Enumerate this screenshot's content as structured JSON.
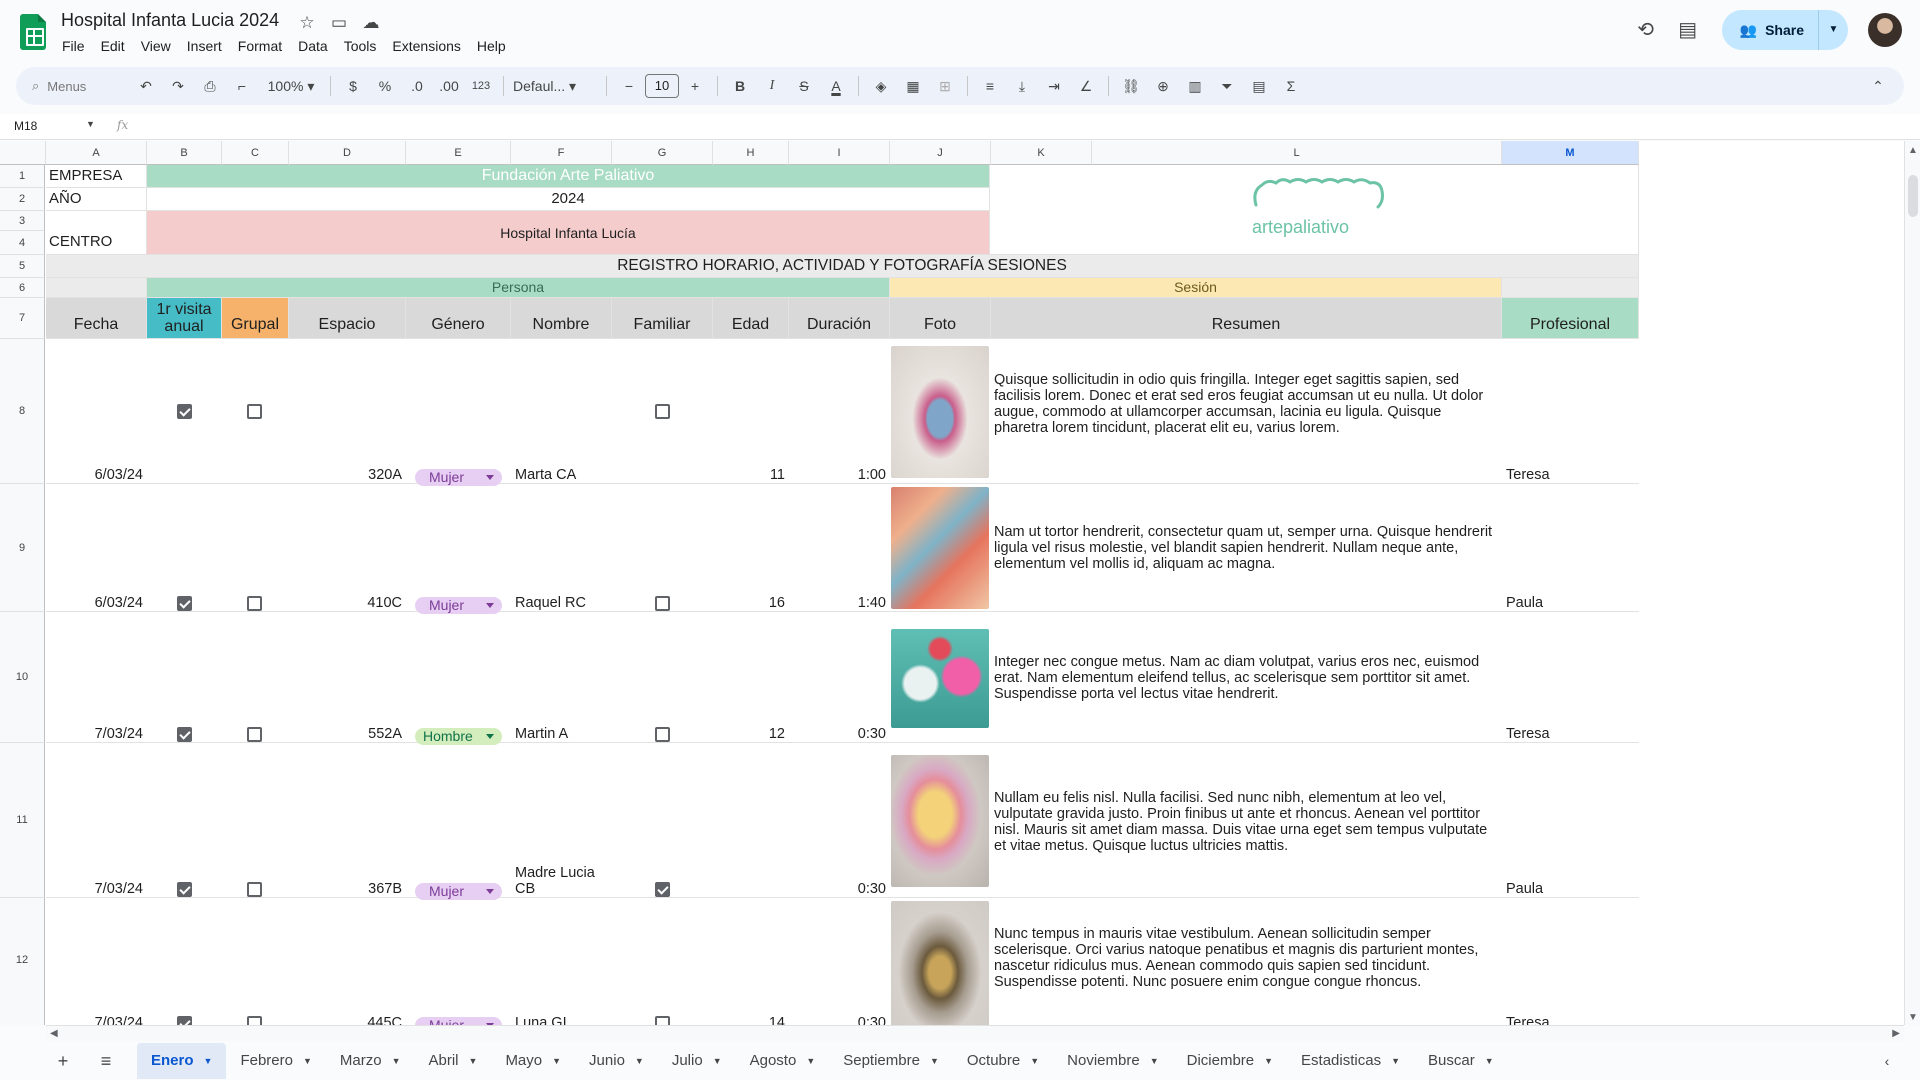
{
  "app": {
    "title": "Hospital Infanta Lucia 2024",
    "menu": [
      "File",
      "Edit",
      "View",
      "Insert",
      "Format",
      "Data",
      "Tools",
      "Extensions",
      "Help"
    ],
    "share_label": "Share"
  },
  "toolbar": {
    "search_placeholder": "Menus",
    "zoom": "100%",
    "currency": "$",
    "percent": "%",
    "dec_decrease": ".0",
    "dec_increase": ".00",
    "number_format": "123",
    "font": "Defaul...",
    "font_size": "10",
    "bold": "B",
    "italic": "I",
    "strike": "S",
    "text_color": "A"
  },
  "formula_bar": {
    "name_box": "M18",
    "fx": "fx"
  },
  "columns": [
    "A",
    "B",
    "C",
    "D",
    "E",
    "F",
    "G",
    "H",
    "I",
    "J",
    "K",
    "L",
    "M"
  ],
  "rows": [
    "1",
    "2",
    "3",
    "4",
    "5",
    "6",
    "7",
    "8",
    "9",
    "10",
    "11",
    "12"
  ],
  "sheet": {
    "empresa_label": "EMPRESA",
    "empresa_value": "Fundación Arte Paliativo",
    "anio_label": "AÑO",
    "anio_value": "2024",
    "centro_label": "CENTRO",
    "centro_value": "Hospital Infanta Lucía",
    "logo_text": "artepaliativo",
    "registro_title": "REGISTRO HORARIO, ACTIVIDAD Y  FOTOGRAFÍA SESIONES",
    "group_persona": "Persona",
    "group_sesion": "Sesión",
    "headers": {
      "fecha": "Fecha",
      "visita": "1r visita anual",
      "grupal": "Grupal",
      "espacio": "Espacio",
      "genero": "Género",
      "nombre": "Nombre",
      "familiar": "Familiar",
      "edad": "Edad",
      "duracion": "Duración",
      "foto": "Foto",
      "resumen": "Resumen",
      "profesional": "Profesional"
    },
    "records": [
      {
        "fecha": "6/03/24",
        "visita": true,
        "grupal": false,
        "espacio": "320A",
        "genero": "Mujer",
        "nombre": "Marta CA",
        "familiar": false,
        "edad": "11",
        "duracion": "1:00",
        "resumen": "Quisque sollicitudin in odio quis fringilla. Integer eget sagittis sapien, sed facilisis lorem. Donec et erat sed eros feugiat accumsan ut eu nulla. Ut dolor augue, commodo at ullamcorper accumsan, lacinia eu ligula. Quisque pharetra lorem tincidunt, placerat elit eu, varius lorem.",
        "profesional": "Teresa"
      },
      {
        "fecha": "6/03/24",
        "visita": true,
        "grupal": false,
        "espacio": "410C",
        "genero": "Mujer",
        "nombre": "Raquel RC",
        "familiar": false,
        "edad": "16",
        "duracion": "1:40",
        "resumen": "Nam ut tortor hendrerit, consectetur quam ut, semper urna. Quisque hendrerit ligula vel risus molestie, vel blandit sapien hendrerit. Nullam neque ante, elementum vel mollis id, aliquam ac magna.",
        "profesional": "Paula"
      },
      {
        "fecha": "7/03/24",
        "visita": true,
        "grupal": false,
        "espacio": "552A",
        "genero": "Hombre",
        "nombre": "Martin A",
        "familiar": false,
        "edad": "12",
        "duracion": "0:30",
        "resumen": "Integer nec congue metus. Nam ac diam volutpat, varius eros nec, euismod erat. Nam elementum eleifend tellus, ac scelerisque sem porttitor sit amet. Suspendisse porta vel lectus vitae hendrerit.",
        "profesional": "Teresa"
      },
      {
        "fecha": "7/03/24",
        "visita": true,
        "grupal": false,
        "espacio": "367B",
        "genero": "Mujer",
        "nombre": "Madre Lucia CB",
        "familiar": true,
        "edad": "",
        "duracion": "0:30",
        "resumen": "Nullam eu felis nisl. Nulla facilisi. Sed nunc nibh, elementum at leo vel, vulputate gravida justo. Proin finibus ut ante et rhoncus. Aenean vel porttitor nisl. Mauris sit amet diam massa. Duis vitae urna eget sem  tempus vulputate et vitae metus. Quisque luctus ultricies mattis.",
        "profesional": "Paula"
      },
      {
        "fecha": "7/03/24",
        "visita": true,
        "grupal": false,
        "espacio": "445C",
        "genero": "Mujer",
        "nombre": "Luna GI",
        "familiar": false,
        "edad": "14",
        "duracion": "0:30",
        "resumen": "Nunc tempus in mauris vitae vestibulum. Aenean sollicitudin semper scelerisque. Orci varius natoque penatibus et magnis dis parturient montes, nascetur ridiculus mus. Aenean commodo quis sapien sed tincidunt. Suspendisse potenti. Nunc posuere enim congue congue rhoncus.",
        "profesional": "Teresa"
      }
    ]
  },
  "tabs": [
    "Enero",
    "Febrero",
    "Marzo",
    "Abril",
    "Mayo",
    "Junio",
    "Julio",
    "Agosto",
    "Septiembre",
    "Octubre",
    "Noviembre",
    "Diciembre",
    "Estadisticas",
    "Buscar"
  ],
  "colors": {
    "persona": "#a8dcc4",
    "sesion": "#fce8b2",
    "centro": "#f4cccc",
    "visita": "#46bdc6",
    "grupal": "#f6b26b",
    "header": "#d9d9d9",
    "chip_mujer": "#e6cff2",
    "chip_hombre": "#d4edbc"
  }
}
